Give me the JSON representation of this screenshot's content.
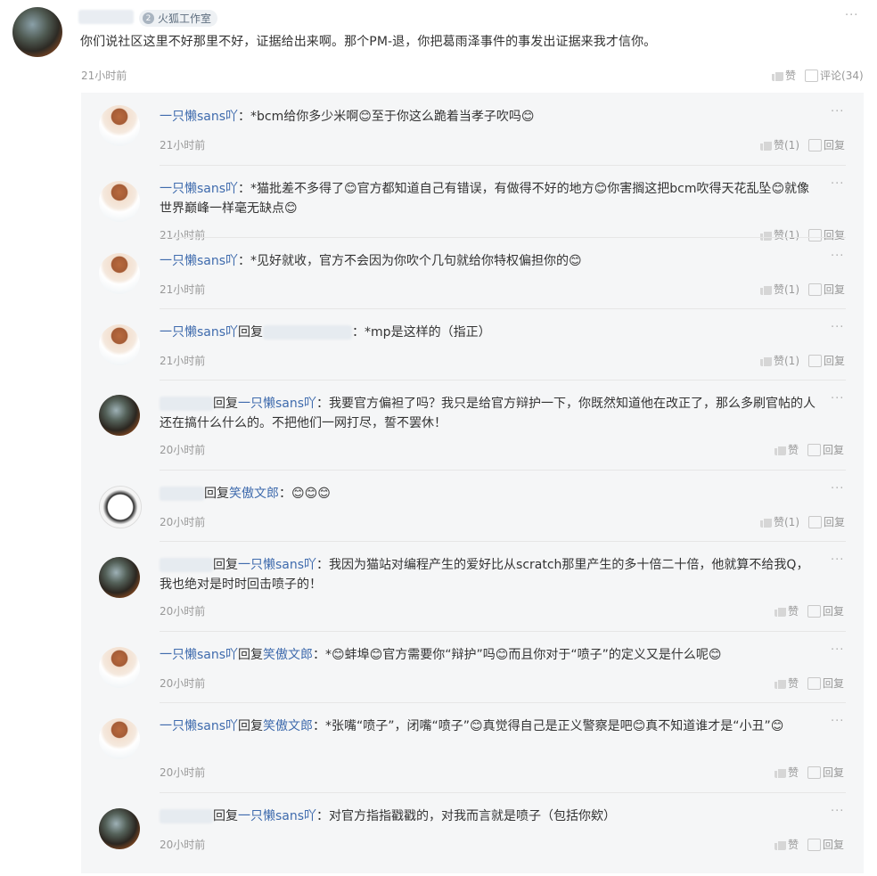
{
  "post": {
    "badge_num": "2",
    "badge_text": "火狐工作室",
    "text": "你们说社区这里不好那里不好，证据给出来啊。那个PM-退，你把葛雨泽事件的事发出证据来我才信你。",
    "time": "21小时前",
    "like_label": "赞",
    "comment_label": "评论(34)",
    "more": "···"
  },
  "replies": [
    {
      "avatar": "girl",
      "user": "一只懒sans吖",
      "reply_word": "",
      "target": "",
      "target_blur": false,
      "colon": "：",
      "text": "*bcm给你多少米啊😊至于你这么跪着当孝子吹吗😊",
      "time": "21小时前",
      "like": "赞(1)",
      "reply": "回复"
    },
    {
      "avatar": "girl",
      "user": "一只懒sans吖",
      "reply_word": "",
      "target": "",
      "target_blur": false,
      "colon": "：",
      "text": "*猫批差不多得了😊官方都知道自己有错误，有做得不好的地方😊你害搁这把bcm吹得天花乱坠😊就像世界巅峰一样毫无缺点😊",
      "time": "21小时前",
      "like": "赞(1)",
      "reply": "回复"
    },
    {
      "avatar": "girl",
      "user": "一只懒sans吖",
      "reply_word": "",
      "target": "",
      "target_blur": false,
      "colon": "：",
      "text": "*见好就收，官方不会因为你吹个几句就给你特权偏担你的😊",
      "time": "21小时前",
      "like": "赞(1)",
      "reply": "回复"
    },
    {
      "avatar": "girl",
      "user": "一只懒sans吖",
      "reply_word": "回复",
      "target": "",
      "target_blur": true,
      "colon": "：",
      "text": "*mp是这样的（指正）",
      "time": "21小时前",
      "like": "赞(1)",
      "reply": "回复"
    },
    {
      "avatar": "dark",
      "user": "",
      "user_blur": true,
      "reply_word": "回复",
      "target": "一只懒sans吖",
      "target_blur": false,
      "colon": "：",
      "text": "我要官方偏袒了吗？我只是给官方辩护一下，你既然知道他在改正了，那么多刷官帖的人还在搞什么什么的。不把他们一网打尽，誓不罢休！",
      "time": "20小时前",
      "like": "赞",
      "reply": "回复"
    },
    {
      "avatar": "mask",
      "user": "",
      "user_blur": true,
      "reply_word": "回复",
      "target": "笑傲文郎",
      "target_blur": false,
      "colon": "：",
      "text": "😊😊😊",
      "time": "20小时前",
      "like": "赞(1)",
      "reply": "回复"
    },
    {
      "avatar": "dark",
      "user": "",
      "user_blur": true,
      "reply_word": "回复",
      "target": "一只懒sans吖",
      "target_blur": false,
      "colon": "：",
      "text": "我因为猫站对编程产生的爱好比从scratch那里产生的多十倍二十倍，他就算不给我Q，我也绝对是时时回击喷子的！",
      "time": "20小时前",
      "like": "赞",
      "reply": "回复"
    },
    {
      "avatar": "girl",
      "user": "一只懒sans吖",
      "reply_word": "回复",
      "target": "笑傲文郎",
      "target_blur": false,
      "colon": "：",
      "text": "*😊蚌埠😊官方需要你“辩护”吗😊而且你对于“喷子”的定义又是什么呢😊",
      "time": "20小时前",
      "like": "赞",
      "reply": "回复"
    },
    {
      "avatar": "girl",
      "user": "一只懒sans吖",
      "reply_word": "回复",
      "target": "笑傲文郎",
      "target_blur": false,
      "colon": "：",
      "text": "*张嘴“喷子”，闭嘴“喷子”😊真觉得自己是正义警察是吧😊真不知道谁才是“小丑”😊",
      "time": "20小时前",
      "like": "赞",
      "reply": "回复"
    },
    {
      "avatar": "dark",
      "user": "",
      "user_blur": true,
      "reply_word": "回复",
      "target": "一只懒sans吖",
      "target_blur": false,
      "colon": "：",
      "text": "对官方指指戳戳的，对我而言就是喷子（包括你欸）",
      "time": "20小时前",
      "like": "赞",
      "reply": "回复"
    }
  ]
}
